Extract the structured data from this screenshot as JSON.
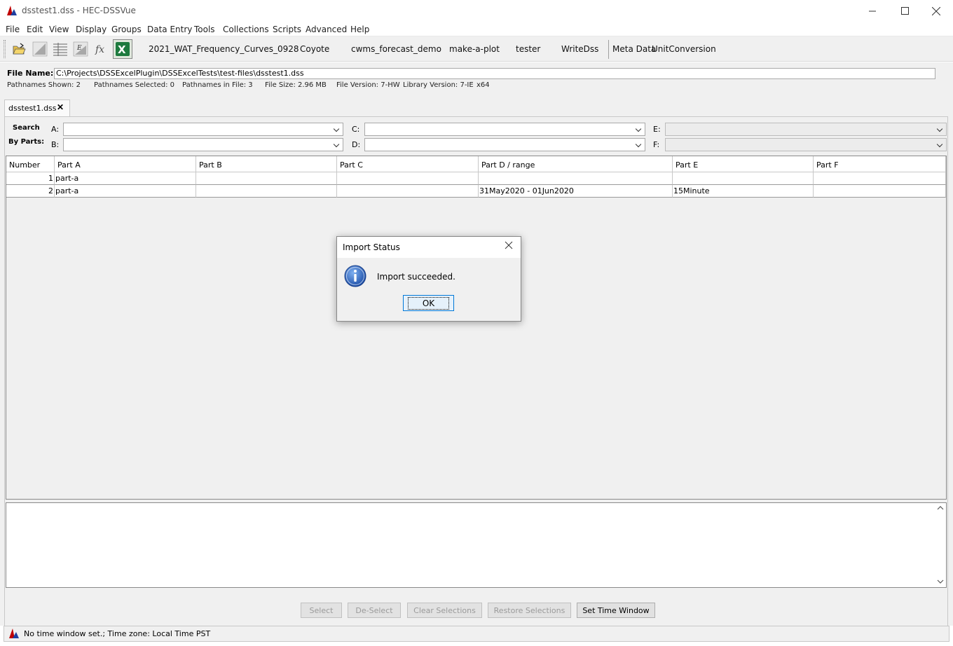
{
  "window": {
    "title": "dsstest1.dss - HEC-DSSVue",
    "minimize": "—",
    "maximize": "☐",
    "close": "✕"
  },
  "menu": [
    "File",
    "Edit",
    "View",
    "Display",
    "Groups",
    "Data Entry",
    "Tools",
    "Collections",
    "Scripts",
    "Advanced",
    "Help"
  ],
  "toolbar": {
    "icons": [
      "open-folder-icon",
      "plot-icon",
      "tabulate-icon",
      "edit-icon",
      "function-icon",
      "excel-icon"
    ],
    "scripts": [
      "2021_WAT_Frequency_Curves_0928",
      "Coyote",
      "cwms_forecast_demo",
      "make-a-plot",
      "tester",
      "WriteDss"
    ],
    "plugins": [
      "Meta Data",
      "UnitConversion"
    ]
  },
  "file": {
    "label": "File Name:",
    "path": "C:\\Projects\\DSSExcelPlugin\\DSSExcelTests\\test-files\\dsstest1.dss"
  },
  "info": {
    "shown": "Pathnames Shown:  2",
    "selected": "Pathnames Selected: 0",
    "in_file": "Pathnames in File:  3",
    "size": "File Size:  2.96  MB",
    "version": "File Version: 7-HW",
    "library": "Library Version: 7-IE",
    "arch": "x64"
  },
  "tab": {
    "label": "dsstest1.dss",
    "close": "✕"
  },
  "search": {
    "label1": "Search",
    "label2": "By Parts:",
    "a": "A:",
    "b": "B:",
    "c": "C:",
    "d": "D:",
    "e": "E:",
    "f": "F:"
  },
  "table": {
    "headers": [
      "Number",
      "Part A",
      "Part B",
      "Part C",
      "Part D / range",
      "Part E",
      "Part F"
    ],
    "rows": [
      [
        "1",
        "part-a",
        "",
        "",
        "",
        "",
        ""
      ],
      [
        "2",
        "part-a",
        "",
        "",
        "31May2020 - 01Jun2020",
        "15Minute",
        ""
      ]
    ]
  },
  "buttons": {
    "select": "Select",
    "deselect": "De-Select",
    "clear": "Clear Selections",
    "restore": "Restore Selections",
    "time_window": "Set Time Window"
  },
  "status": {
    "text": "No time window set.;  Time zone: Local Time PST"
  },
  "dialog": {
    "title": "Import Status",
    "message": "Import succeeded.",
    "ok": "OK",
    "close": "✕"
  },
  "colors": {
    "accent": "#0078d7",
    "info_icon": "#2a5fb5"
  }
}
